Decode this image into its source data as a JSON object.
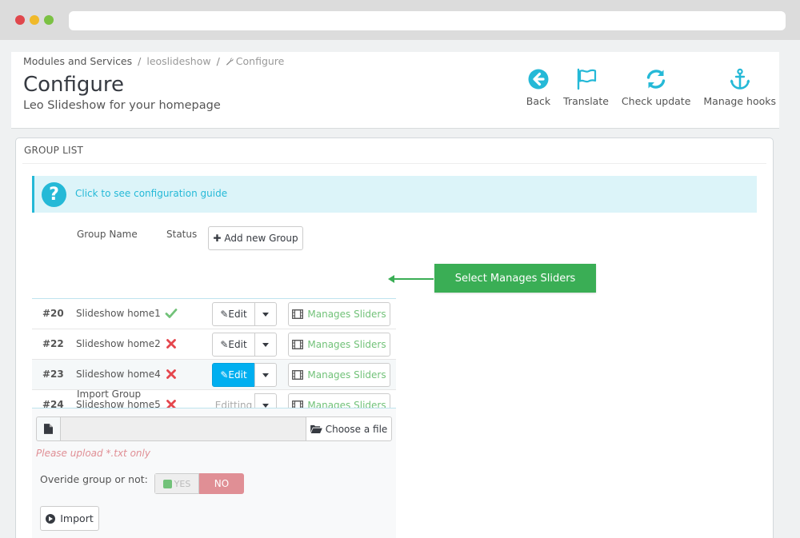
{
  "breadcrumb": {
    "items": [
      "Modules and Services",
      "leoslideshow",
      "Configure"
    ],
    "separator": "/"
  },
  "header": {
    "title": "Configure",
    "subtitle": "Leo Slideshow for your homepage"
  },
  "toolbar": {
    "back": "Back",
    "translate": "Translate",
    "check_update": "Check update",
    "manage_hooks": "Manage hooks"
  },
  "panel": {
    "heading": "GROUP LIST",
    "alert_text": "Click to see configuration guide",
    "columns": {
      "group_name": "Group Name",
      "status": "Status"
    },
    "add_group_label": "Add new Group",
    "rows": [
      {
        "id": "#20",
        "name": "Slideshow home1",
        "status": "enabled",
        "edit_label": "Edit",
        "manage_label": "Manages Sliders"
      },
      {
        "id": "#22",
        "name": "Slideshow home2",
        "status": "disabled",
        "edit_label": "Edit",
        "manage_label": "Manages Sliders"
      },
      {
        "id": "#23",
        "name": "Slideshow home4",
        "status": "disabled",
        "edit_label": "Edit",
        "manage_label": "Manages Sliders"
      },
      {
        "id": "#24",
        "name": "Slideshow home5",
        "status": "disabled",
        "edit_label": "Editting",
        "manage_label": "Manages Sliders"
      }
    ],
    "import": {
      "label": "Import Group",
      "choose_file": "Choose a file",
      "hint": "Please upload *.txt only",
      "override_label": "Overide group or not:",
      "yes": "YES",
      "no": "NO",
      "import_button": "Import"
    }
  },
  "callout": {
    "text": "Select Manages Sliders"
  },
  "colors": {
    "accent": "#25b9d7",
    "edit_active": "#00aff0",
    "success": "#72c279",
    "danger": "#e5464d",
    "callout": "#3aae55",
    "toggle_no": "#e08f95"
  },
  "icons": {
    "back": "arrow-circle-left-icon",
    "translate": "flag-icon",
    "check_update": "refresh-icon",
    "manage_hooks": "anchor-icon",
    "help": "question-circle-icon",
    "enabled": "check-icon",
    "disabled": "x-icon",
    "edit": "pencil-icon",
    "manage": "film-icon",
    "file": "file-icon",
    "folder": "folder-open-icon",
    "import": "circle-arrow-right-icon"
  }
}
